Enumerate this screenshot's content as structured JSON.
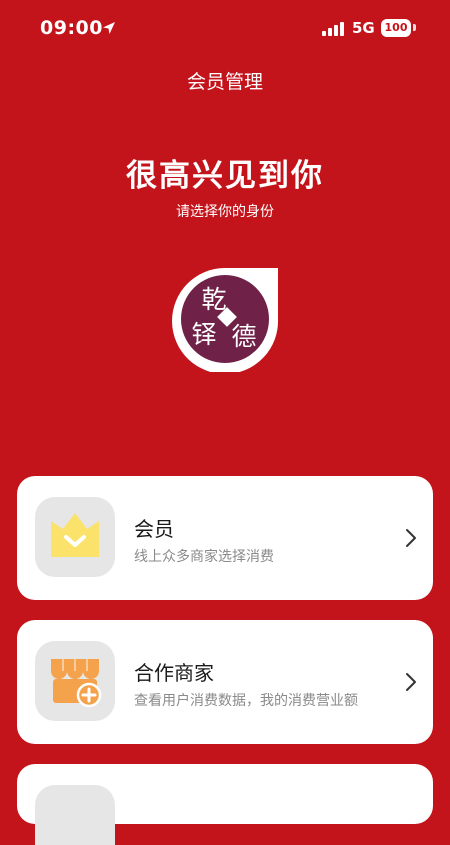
{
  "status": {
    "time": "09:00",
    "network": "5G",
    "battery": "100"
  },
  "header": {
    "title": "会员管理"
  },
  "hero": {
    "headline": "很高兴见到你",
    "subline": "请选择你的身份"
  },
  "logo": {
    "text": [
      "乾",
      "铎",
      "德"
    ]
  },
  "roles": [
    {
      "title": "会员",
      "desc": "线上众多商家选择消费",
      "icon": "crown-icon"
    },
    {
      "title": "合作商家",
      "desc": "查看用户消费数据，我的消费营业额",
      "icon": "store-icon"
    },
    {
      "title": "",
      "desc": "",
      "icon": "role-icon"
    }
  ],
  "colors": {
    "background": "#C4141B",
    "logo_circle": "#6F2147",
    "crown": "#FBE36B",
    "store": "#F4A24C"
  }
}
